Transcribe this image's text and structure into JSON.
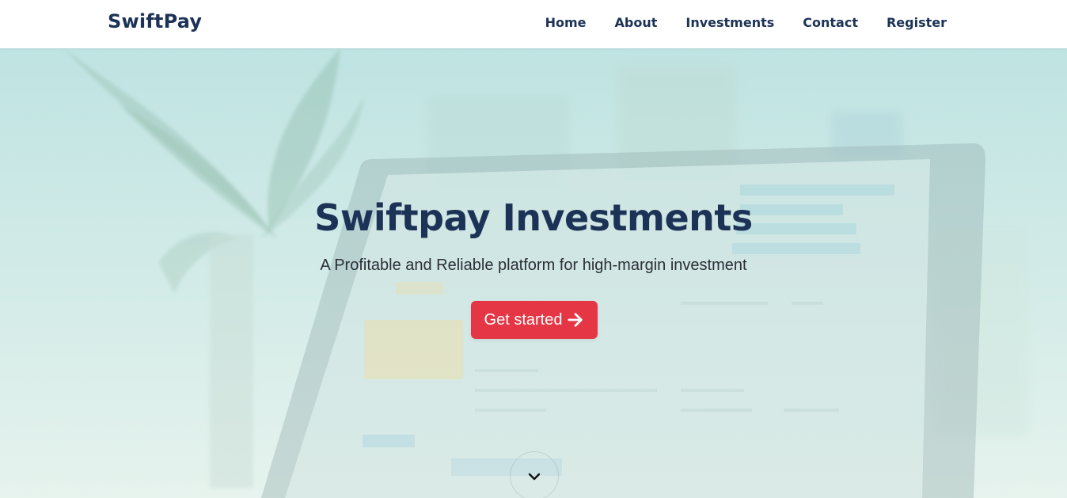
{
  "navbar": {
    "brand": "SwiftPay",
    "links": [
      {
        "label": "Home"
      },
      {
        "label": "About"
      },
      {
        "label": "Investments"
      },
      {
        "label": "Contact"
      },
      {
        "label": "Register"
      }
    ]
  },
  "hero": {
    "title": "Swiftpay Investments",
    "subtitle": "A Profitable and Reliable platform for high-margin investment",
    "cta_label": "Get started",
    "cta_icon": "arrow-right-icon",
    "scroll_icon": "chevron-down-icon"
  },
  "colors": {
    "brand_navy": "#1c3256",
    "cta_red": "#e53645",
    "hero_teal": "#bfe3e2"
  }
}
